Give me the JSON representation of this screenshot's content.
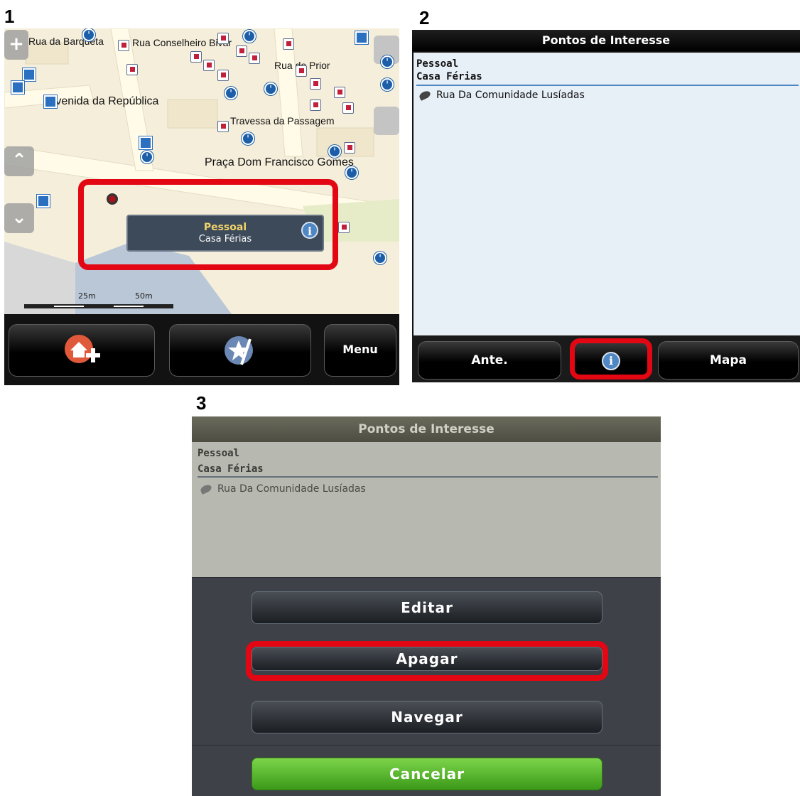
{
  "steps": {
    "s1": "1",
    "s2": "2",
    "s3": "3"
  },
  "panel1": {
    "streets": {
      "barqueta": "Rua da Barqueta",
      "conselheiro": "Rua Conselheiro Bivar",
      "prior": "Rua do Prior",
      "republica": "Avenida da República",
      "passagem": "Travessa da Passagem",
      "praca": "Praça Dom Francisco Gomes"
    },
    "callout": {
      "category": "Pessoal",
      "name": "Casa Férias",
      "info_icon": "info-icon"
    },
    "scale": {
      "s25": "25m",
      "s50": "50m"
    },
    "buttons": {
      "menu": "Menu",
      "add_home_icon": "add-home-icon",
      "favorites_icon": "star-icon"
    }
  },
  "panel2": {
    "title": "Pontos de Interesse",
    "category": "Pessoal",
    "subcategory": "Casa Férias",
    "entry": "Rua Da Comunidade Lusíadas",
    "buttons": {
      "prev": "Ante.",
      "map": "Mapa",
      "info_icon": "info-icon"
    }
  },
  "panel3": {
    "title": "Pontos de Interesse",
    "category": "Pessoal",
    "subcategory": "Casa Férias",
    "entry": "Rua Da Comunidade Lusíadas",
    "buttons": {
      "edit": "Editar",
      "delete": "Apagar",
      "navigate": "Navegar",
      "cancel": "Cancelar"
    }
  },
  "colors": {
    "highlight": "#e30613",
    "accent_blue": "#4f86c4",
    "cancel_green": "#4fb52a"
  }
}
